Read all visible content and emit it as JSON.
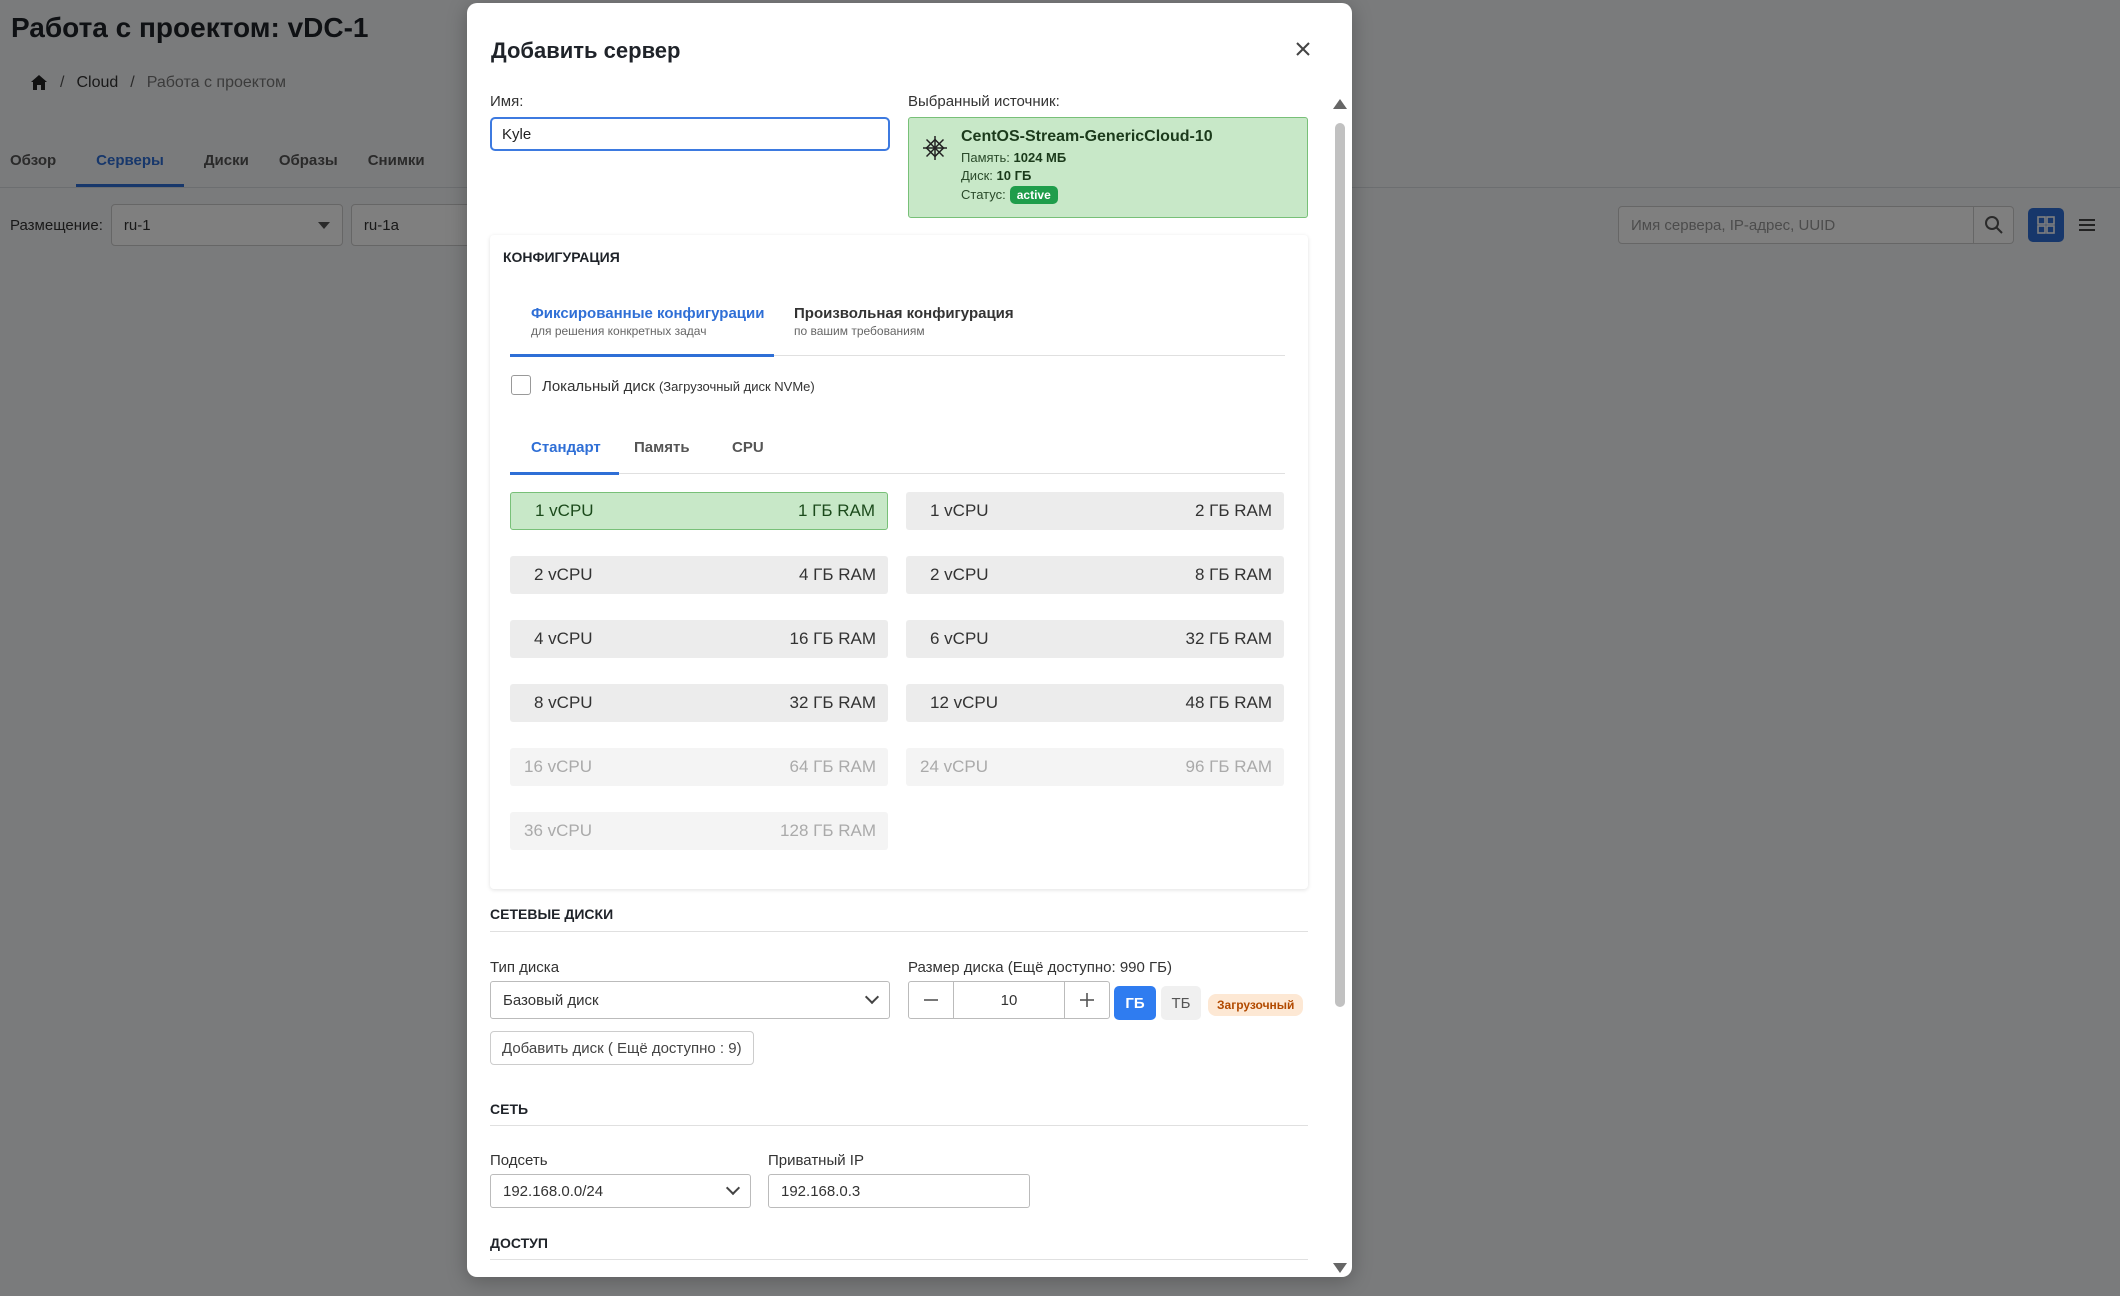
{
  "page": {
    "title": "Работа с проектом: vDC-1",
    "breadcrumb": [
      "Cloud",
      "Работа с проектом"
    ],
    "tabs": [
      "Обзор",
      "Серверы",
      "Диски",
      "Образы",
      "Снимки"
    ],
    "active_tab": "Серверы",
    "placement_label": "Размещение:",
    "region": "ru-1",
    "zone": "ru-1a",
    "search_placeholder": "Имя сервера, IP-адрес, UUID"
  },
  "modal": {
    "title": "Добавить сервер",
    "name_label": "Имя:",
    "name_value": "Kyle",
    "source_label": "Выбранный источник:",
    "source": {
      "name": "CentOS-Stream-GenericCloud-10",
      "memory_label": "Память:",
      "memory": "1024 МБ",
      "disk_label": "Диск:",
      "disk": "10 ГБ",
      "status_label": "Статус:",
      "status": "active"
    },
    "config": {
      "heading": "КОНФИГУРАЦИЯ",
      "tabs": [
        {
          "title": "Фиксированные конфигурации",
          "subtitle": "для решения конкретных задач"
        },
        {
          "title": "Произвольная конфигурация",
          "subtitle": "по вашим требованиям"
        }
      ],
      "local_disk_label": "Локальный диск",
      "local_disk_note": "(Загрузочный диск NVMe)",
      "subtabs": [
        "Стандарт",
        "Память",
        "CPU"
      ],
      "presets": [
        {
          "cpu": "1 vCPU",
          "ram": "1 ГБ RAM",
          "state": "selected"
        },
        {
          "cpu": "1 vCPU",
          "ram": "2 ГБ RAM",
          "state": "normal"
        },
        {
          "cpu": "2 vCPU",
          "ram": "4 ГБ RAM",
          "state": "normal"
        },
        {
          "cpu": "2 vCPU",
          "ram": "8 ГБ RAM",
          "state": "normal"
        },
        {
          "cpu": "4 vCPU",
          "ram": "16 ГБ RAM",
          "state": "normal"
        },
        {
          "cpu": "6 vCPU",
          "ram": "32 ГБ RAM",
          "state": "normal"
        },
        {
          "cpu": "8 vCPU",
          "ram": "32 ГБ RAM",
          "state": "normal"
        },
        {
          "cpu": "12 vCPU",
          "ram": "48 ГБ RAM",
          "state": "normal"
        },
        {
          "cpu": "16 vCPU",
          "ram": "64 ГБ RAM",
          "state": "disabled"
        },
        {
          "cpu": "24 vCPU",
          "ram": "96 ГБ RAM",
          "state": "disabled"
        },
        {
          "cpu": "36 vCPU",
          "ram": "128 ГБ RAM",
          "state": "disabled"
        }
      ]
    },
    "disks": {
      "heading": "СЕТЕВЫЕ ДИСКИ",
      "type_label": "Тип диска",
      "type_value": "Базовый диск",
      "size_label": "Размер диска (Ещё доступно: 990 ГБ)",
      "size_value": "10",
      "unit_gb": "ГБ",
      "unit_tb": "ТБ",
      "boot_badge": "Загрузочный",
      "add_disk": "Добавить диск (  Ещё доступно   : 9)"
    },
    "network": {
      "heading": "СЕТЬ",
      "subnet_label": "Подсеть",
      "subnet_value": "192.168.0.0/24",
      "ip_label": "Приватный IP",
      "ip_value": "192.168.0.3"
    },
    "access": {
      "heading": "ДОСТУП"
    }
  },
  "colors": {
    "accent": "#2f6fd6",
    "selected_bg": "#c8e8c8",
    "status_active": "#1f9d4b"
  }
}
